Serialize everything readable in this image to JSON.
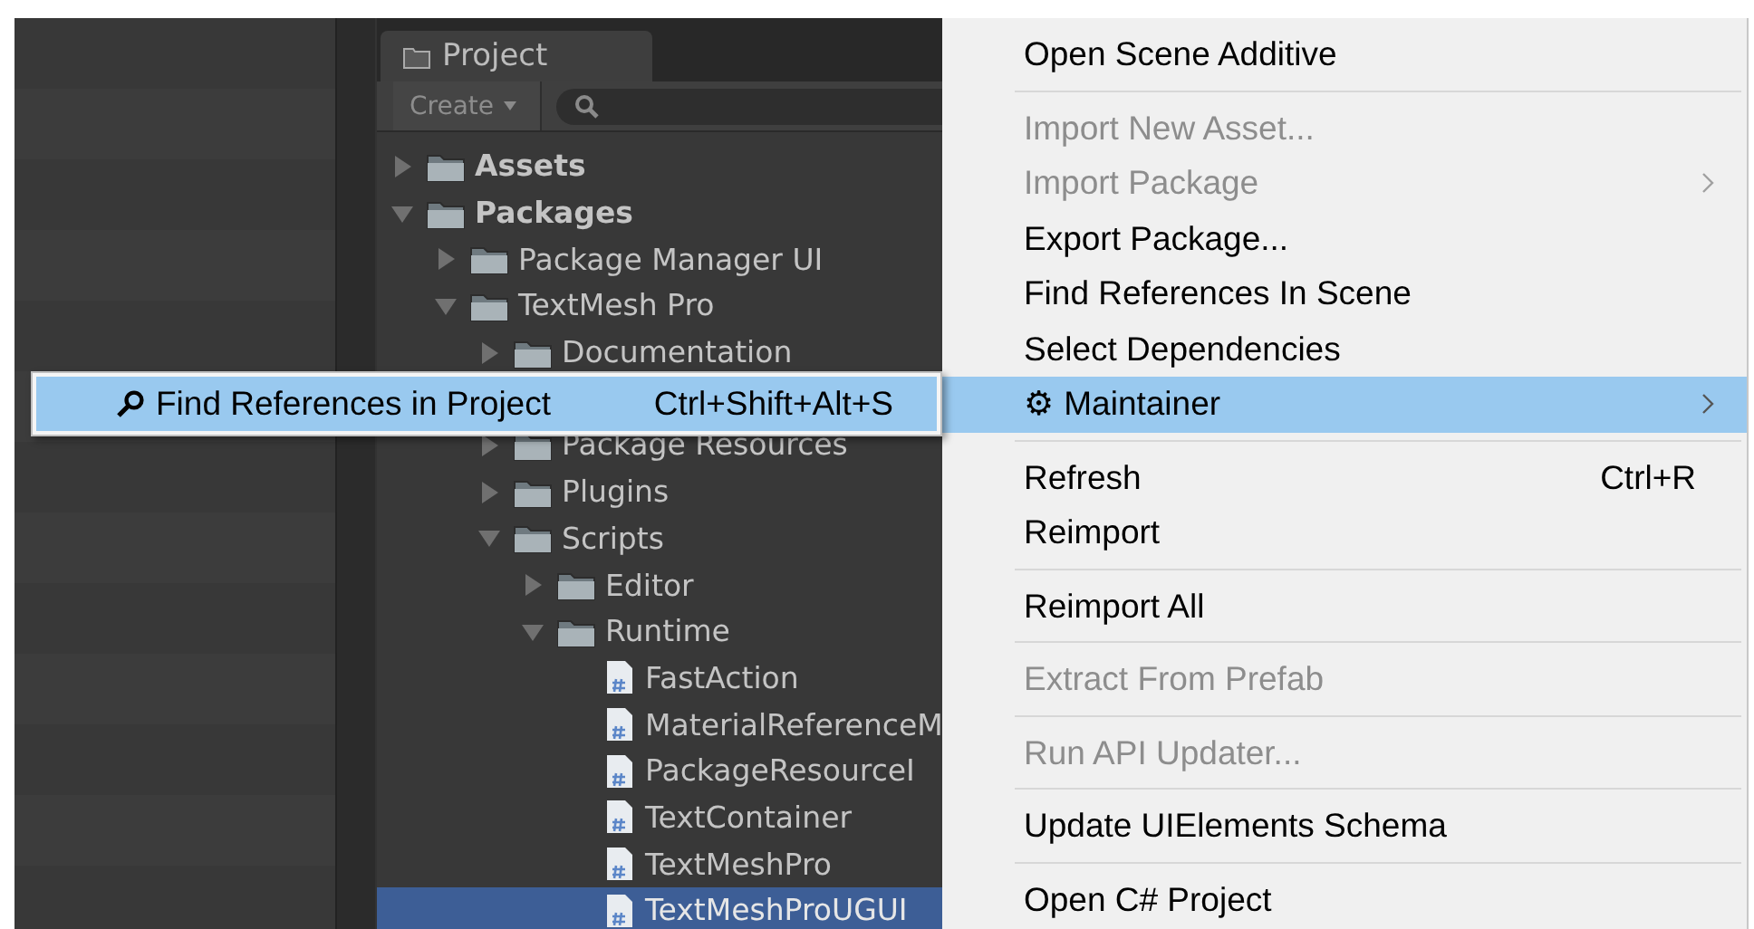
{
  "project": {
    "tab": "Project",
    "create_button": "Create",
    "tree": [
      {
        "label": "Assets",
        "kind": "folder",
        "bold": true,
        "expanded": false,
        "selected": false
      },
      {
        "label": "Packages",
        "kind": "folder",
        "bold": true,
        "expanded": true,
        "selected": false,
        "children": [
          {
            "label": "Package Manager UI",
            "kind": "folder",
            "expanded": false,
            "selected": false
          },
          {
            "label": "TextMesh Pro",
            "kind": "folder",
            "expanded": true,
            "selected": false,
            "children": [
              {
                "label": "Documentation",
                "kind": "folder",
                "expanded": false,
                "selected": false
              },
              {
                "label": "Package Resources",
                "kind": "folder",
                "expanded": false,
                "selected": false
              },
              {
                "label": "Plugins",
                "kind": "folder",
                "expanded": false,
                "selected": false
              },
              {
                "label": "Scripts",
                "kind": "folder",
                "expanded": true,
                "selected": false,
                "children": [
                  {
                    "label": "Editor",
                    "kind": "folder",
                    "expanded": false,
                    "selected": false
                  },
                  {
                    "label": "Runtime",
                    "kind": "folder",
                    "expanded": true,
                    "selected": false,
                    "children": [
                      {
                        "label": "FastAction",
                        "kind": "script",
                        "selected": false
                      },
                      {
                        "label": "MaterialReferenceM",
                        "kind": "script",
                        "selected": false
                      },
                      {
                        "label": "PackageResourceI",
                        "kind": "script",
                        "selected": false
                      },
                      {
                        "label": "TextContainer",
                        "kind": "script",
                        "selected": false
                      },
                      {
                        "label": "TextMeshPro",
                        "kind": "script",
                        "selected": false
                      },
                      {
                        "label": "TextMeshProUGUI",
                        "kind": "script",
                        "selected": true
                      }
                    ]
                  }
                ]
              }
            ]
          }
        ]
      }
    ]
  },
  "context_menu": {
    "items": [
      {
        "kind": "item",
        "label": "Open Scene Additive",
        "disabled": false,
        "selected": false
      },
      {
        "kind": "separator"
      },
      {
        "kind": "item",
        "label": "Import New Asset...",
        "disabled": true,
        "selected": false
      },
      {
        "kind": "item",
        "label": "Import Package",
        "disabled": true,
        "selected": false,
        "submenu_arrow": true
      },
      {
        "kind": "item",
        "label": "Export Package...",
        "disabled": false,
        "selected": false
      },
      {
        "kind": "item",
        "label": "Find References In Scene",
        "disabled": false,
        "selected": false
      },
      {
        "kind": "item",
        "label": "Select Dependencies",
        "disabled": false,
        "selected": false
      },
      {
        "kind": "item",
        "label": "⚙ Maintainer",
        "disabled": false,
        "selected": true,
        "submenu_arrow": true,
        "submenu": [
          {
            "label": "Find References in Project",
            "shortcut": "Ctrl+Shift+Alt+S",
            "selected": true
          }
        ]
      },
      {
        "kind": "separator"
      },
      {
        "kind": "item",
        "label": "Refresh",
        "disabled": false,
        "selected": false,
        "shortcut": "Ctrl+R"
      },
      {
        "kind": "item",
        "label": "Reimport",
        "disabled": false,
        "selected": false
      },
      {
        "kind": "separator"
      },
      {
        "kind": "item",
        "label": "Reimport All",
        "disabled": false,
        "selected": false
      },
      {
        "kind": "separator"
      },
      {
        "kind": "item",
        "label": "Extract From Prefab",
        "disabled": true,
        "selected": false
      },
      {
        "kind": "separator"
      },
      {
        "kind": "item",
        "label": "Run API Updater...",
        "disabled": true,
        "selected": false
      },
      {
        "kind": "separator"
      },
      {
        "kind": "item",
        "label": "Update UIElements Schema",
        "disabled": false,
        "selected": false
      },
      {
        "kind": "separator"
      },
      {
        "kind": "item",
        "label": "Open C# Project",
        "disabled": false,
        "selected": false
      }
    ]
  }
}
